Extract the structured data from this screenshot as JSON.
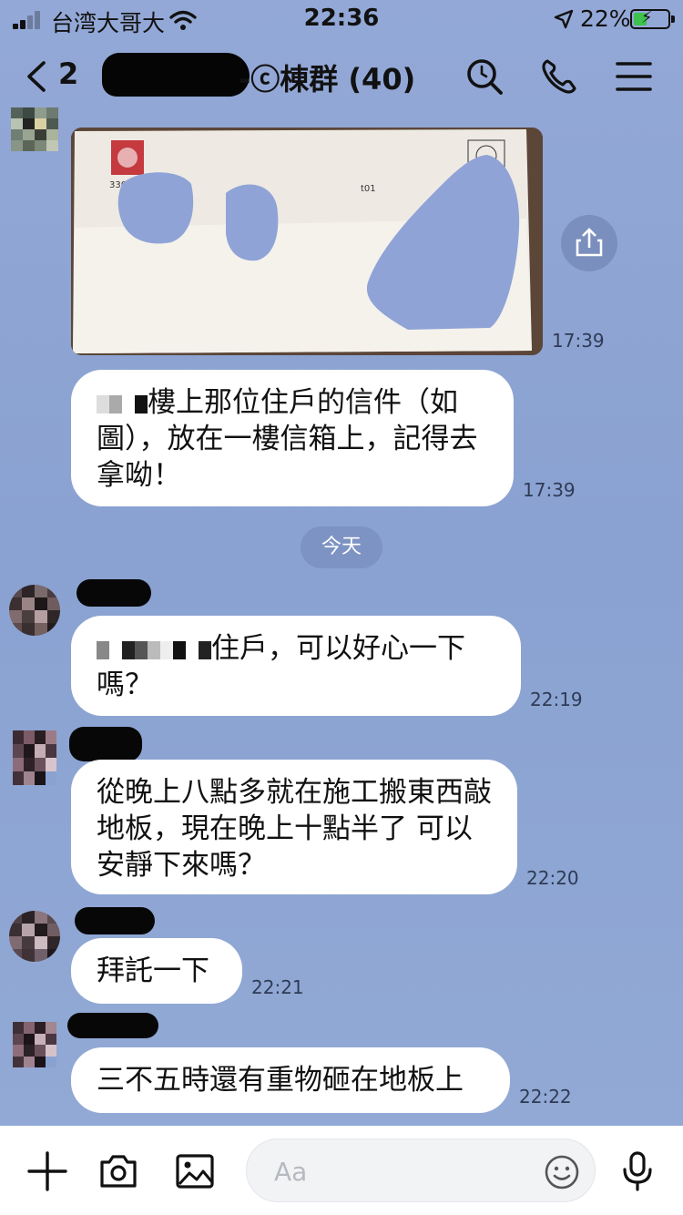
{
  "status_bar": {
    "carrier": "台湾大哥大",
    "time": "22:36",
    "battery_percent": "22%",
    "battery_level": 0.22
  },
  "header": {
    "back_count": "2",
    "title": "-ⓒ棟群 (40)",
    "icons": [
      "back-chevron-icon",
      "search-icon",
      "phone-icon",
      "menu-icon"
    ]
  },
  "messages": [
    {
      "type": "image",
      "time": "17:39"
    },
    {
      "type": "text",
      "text_tail": "樓上那位住戶的信件（如圖），放在一樓信箱上，記得去拿呦！",
      "time": "17:39"
    },
    {
      "type": "text",
      "text_tail": "住戶，可以好心一下嗎？",
      "time": "22:19"
    },
    {
      "type": "text",
      "text": "從晚上八點多就在施工搬東西敲地板，現在晚上十點半了 可以安靜下來嗎？",
      "time": "22:20"
    },
    {
      "type": "text",
      "text": "拜託一下",
      "time": "22:21"
    },
    {
      "type": "text",
      "text": "三不五時還有重物砸在地板上",
      "time": "22:22"
    }
  ],
  "photo": {
    "label_code": "3300",
    "label_room": "t01"
  },
  "date_separator": "今天",
  "input_bar": {
    "placeholder": "Aa",
    "icons": [
      "plus-icon",
      "camera-icon",
      "image-icon",
      "emoji-icon",
      "microphone-icon"
    ]
  },
  "colors": {
    "chat_background": "#8ea5d3",
    "bubble": "#ffffff",
    "date_chip": "#7d93c4",
    "battery_charging": "#3ec14d"
  }
}
